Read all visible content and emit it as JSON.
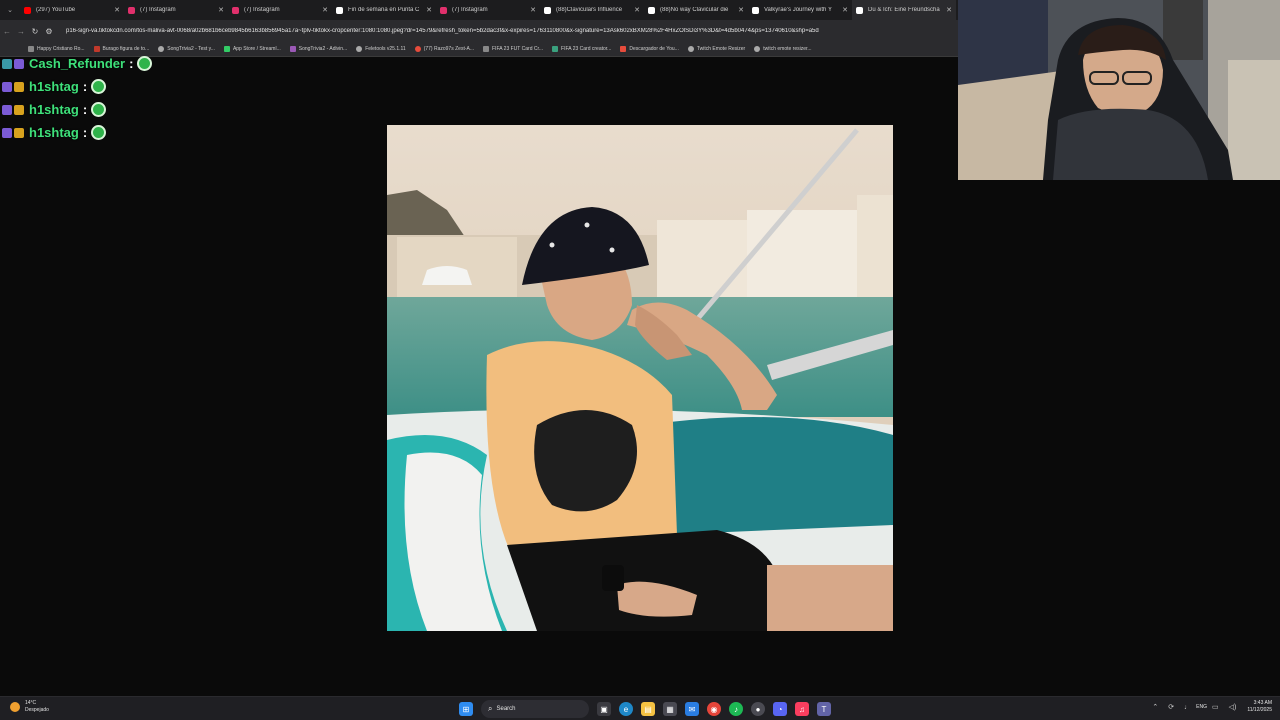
{
  "browser": {
    "tabs": [
      {
        "title": "(297) YouTube",
        "favicon_color": "#ff0000"
      },
      {
        "title": "(7) Instagram",
        "favicon_color": "#e1306c"
      },
      {
        "title": "(7) Instagram",
        "favicon_color": "#e1306c"
      },
      {
        "title": "Fin de semana en Punta C",
        "favicon_color": "#ffffff"
      },
      {
        "title": "(7) Instagram",
        "favicon_color": "#e1306c"
      },
      {
        "title": "(88)Claviculars Influence",
        "favicon_color": "#ffffff"
      },
      {
        "title": "(88)No way Clavicular die",
        "favicon_color": "#ffffff"
      },
      {
        "title": "Valkyrae's Journey with Y",
        "favicon_color": "#ffffff"
      },
      {
        "title": "Du & Ich: Eine Freundscha",
        "favicon_color": "#ffffff"
      }
    ],
    "url": "p16-sign-va.tiktokcdn.com/tos-maliva-avt-0068/a02b681b6ceb9845b6163b856945a17a~tplv-tiktokx-cropcenter:1080:1080.jpeg?dr=14579&refresh_token=5b2dac3f&x-expires=1763110800&x-signature=13Ask602xBXM28%2F4HxZOlSDi3Y%3D&t=4d5b0474&ps=13740610&shp=a5d",
    "bookmarks": [
      {
        "label": "Happy Cristiano Ro...",
        "color": "#888888"
      },
      {
        "label": "Burago figura de to...",
        "color": "#c0392b"
      },
      {
        "label": "SongTrivia2 - Test y...",
        "color": "#aaaaaa"
      },
      {
        "label": "App Store / Streaml...",
        "color": "#33cc66"
      },
      {
        "label": "SongTrivia2 - Adivin...",
        "color": "#9b59b6"
      },
      {
        "label": "Feletools v25.1.11",
        "color": "#aaaaaa"
      },
      {
        "label": "(77) Razo97s Zest-A...",
        "color": "#e74c3c"
      },
      {
        "label": "FIFA 23 FUT Card Cr...",
        "color": "#888888"
      },
      {
        "label": "FIFA 23 Card creator...",
        "color": "#3aa17e"
      },
      {
        "label": "Descargador de You...",
        "color": "#e74c3c"
      },
      {
        "label": "Twitch Emote Resizer",
        "color": "#aaaaaa"
      },
      {
        "label": "twitch emote resizer...",
        "color": "#aaaaaa"
      }
    ]
  },
  "chat": [
    {
      "user": "Cash_Refunder",
      "colon": ":"
    },
    {
      "user": "h1shtag",
      "colon": ":"
    },
    {
      "user": "h1shtag",
      "colon": ":"
    },
    {
      "user": "h1shtag",
      "colon": ":"
    }
  ],
  "taskbar": {
    "weather_temp": "14°C",
    "weather_desc": "Despejado",
    "search_label": "Search",
    "lang": "ENG",
    "time": "3:43 AM",
    "date": "11/12/2025"
  }
}
